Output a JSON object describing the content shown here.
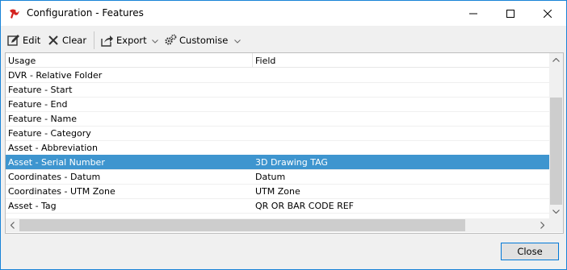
{
  "window": {
    "title": "Configuration - Features",
    "accent": "#1883d7",
    "icons": [
      "app-icon",
      "minimize-icon",
      "maximize-icon",
      "close-icon"
    ]
  },
  "toolbar": {
    "edit_label": "Edit",
    "clear_label": "Clear",
    "export_label": "Export",
    "customise_label": "Customise"
  },
  "grid": {
    "columns": [
      "Usage",
      "Field"
    ],
    "rows": [
      {
        "usage": "DVR - Relative Folder",
        "field": ""
      },
      {
        "usage": "Feature - Start",
        "field": ""
      },
      {
        "usage": "Feature - End",
        "field": ""
      },
      {
        "usage": "Feature - Name",
        "field": ""
      },
      {
        "usage": "Feature - Category",
        "field": ""
      },
      {
        "usage": "Asset - Abbreviation",
        "field": ""
      },
      {
        "usage": "Asset - Serial Number",
        "field": "3D Drawing TAG",
        "selected": true
      },
      {
        "usage": "Coordinates - Datum",
        "field": "Datum"
      },
      {
        "usage": "Coordinates - UTM Zone",
        "field": "UTM Zone"
      },
      {
        "usage": "Asset - Tag",
        "field": "QR OR BAR CODE REF"
      }
    ],
    "selection_color": "#3e95cf"
  },
  "footer": {
    "close_label": "Close"
  }
}
